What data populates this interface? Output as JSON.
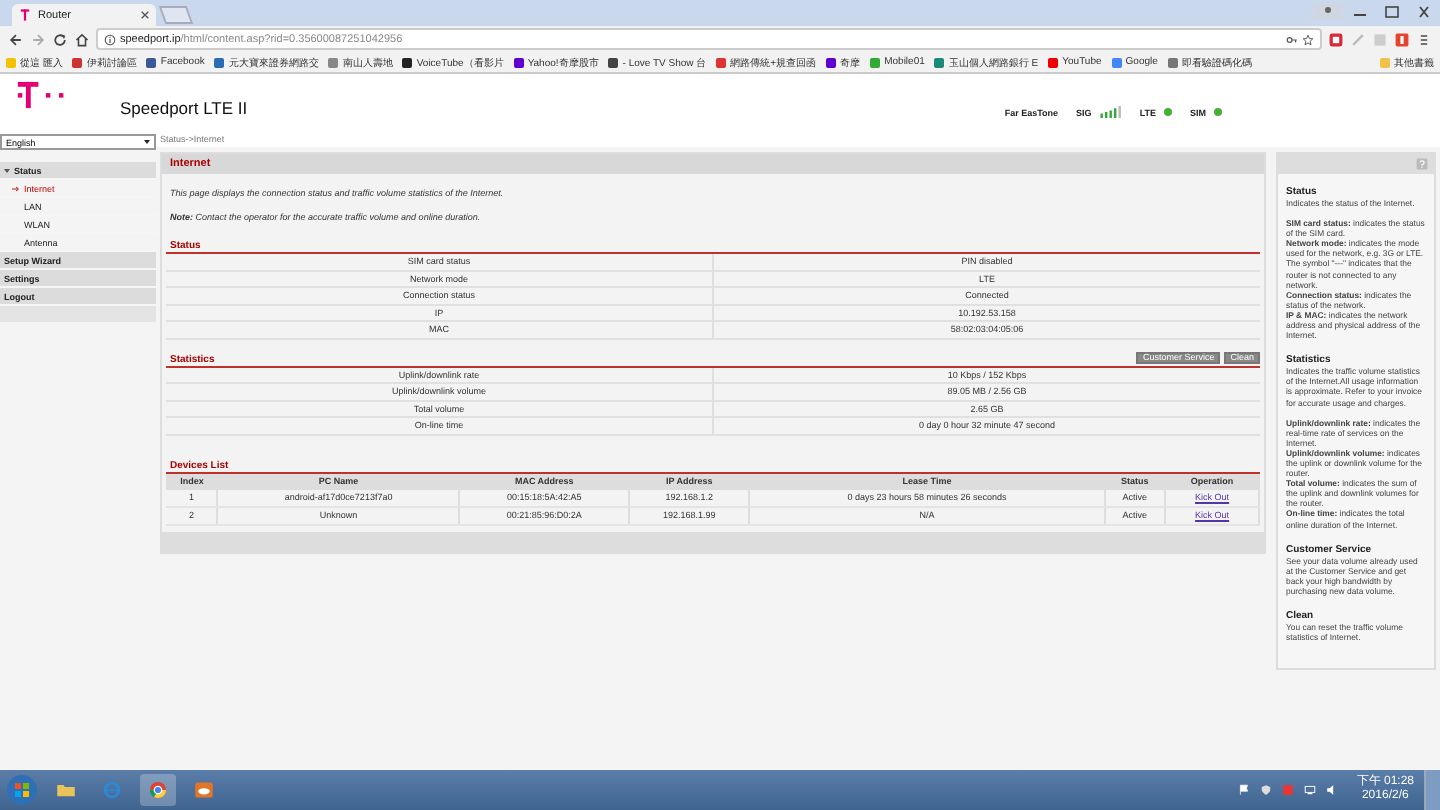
{
  "browser": {
    "tab_title": "Router",
    "url_host": "speedport.ip",
    "url_path": "/html/content.asp?rid=0.35600087251042956",
    "bookmarks": [
      "從這 匯入",
      "伊莉討論區",
      "Facebook",
      "元大寶來證券網路交",
      "南山人壽地",
      "VoiceTube（看影片",
      "Yahoo!奇摩股市",
      "- Love TV Show 台",
      "網路傳統+規查回函",
      "奇摩",
      "Mobile01",
      "玉山個人網路銀行 E",
      "YouTube",
      "Google",
      "即看驗證碼化碼"
    ],
    "other_bookmarks": "其他書籤"
  },
  "header": {
    "title": "Speedport LTE II",
    "operator": "Far EasTone",
    "signal_label": "SIG",
    "indicators": [
      {
        "label": "LTE",
        "color": "#44b035"
      },
      {
        "label": "SIM",
        "color": "#44b035"
      }
    ]
  },
  "sidebar": {
    "language": "English",
    "items": [
      {
        "label": "Status",
        "selected": false,
        "expanded": true,
        "children": [
          {
            "label": "Internet",
            "selected": true
          },
          {
            "label": "LAN",
            "selected": false
          },
          {
            "label": "WLAN",
            "selected": false
          },
          {
            "label": "Antenna",
            "selected": false
          }
        ]
      },
      {
        "label": "Setup Wizard",
        "selected": false
      },
      {
        "label": "Settings",
        "selected": false
      },
      {
        "label": "Logout",
        "selected": false
      }
    ]
  },
  "breadcrumb": "Status->Internet",
  "panel": {
    "title": "Internet",
    "intro": "This page displays the connection status and traffic volume statistics of the Internet.",
    "note": "**Note:** Contact the operator for the accurate traffic volume and online duration."
  },
  "status": {
    "title": "Status",
    "rows": [
      {
        "label": "SIM card status",
        "value": "PIN disabled"
      },
      {
        "label": "Network mode",
        "value": "LTE"
      },
      {
        "label": "Connection status",
        "value": "Connected"
      },
      {
        "label": "IP",
        "value": "10.192.53.158"
      },
      {
        "label": "MAC",
        "value": "58:02:03:04:05:06"
      }
    ]
  },
  "statistics": {
    "title": "Statistics",
    "buttons": [
      "Customer Service",
      "Clean"
    ],
    "rows": [
      {
        "label": "Uplink/downlink rate",
        "value": "10 Kbps / 152 Kbps"
      },
      {
        "label": "Uplink/downlink volume",
        "value": "89.05 MB / 2.56 GB"
      },
      {
        "label": "Total volume",
        "value": "2.65 GB"
      },
      {
        "label": "On-line time",
        "value": "0 day 0 hour 32 minute 47 second"
      }
    ]
  },
  "devices": {
    "title": "Devices List",
    "columns": [
      "Index",
      "PC Name",
      "MAC Address",
      "IP Address",
      "Lease Time",
      "Status",
      "Operation"
    ],
    "rows": [
      {
        "cells": [
          "1",
          "android-af17d0ce7213f7a0",
          "00:15:18:5A:42:A5",
          "192.168.1.2",
          "0 days 23 hours 58 minutes 26 seconds",
          "Active"
        ],
        "action": "Kick Out"
      },
      {
        "cells": [
          "2",
          "Unknown",
          "00:21:85:96:D0:2A",
          "192.168.1.99",
          "N/A",
          "Active"
        ],
        "action": "Kick Out"
      }
    ]
  },
  "help": {
    "sections": [
      {
        "title": "Status",
        "paragraphs": [
          "Indicates the status of the Internet.",
          "**SIM card status:** indicates the status of the SIM card.",
          "**Network mode:** indicates the mode used for the network, e.g. 3G or LTE. The symbol \"---\" indicates that the router is not connected to any network.",
          "**Connection status:** indicates the status of the network.",
          "**IP & MAC:** indicates the network address and physical address of the Internet."
        ]
      },
      {
        "title": "Statistics",
        "paragraphs": [
          "Indicates the traffic volume statistics of the Internet.All usage information is approximate. Refer to your invoice for accurate usage and charges.",
          "**Uplink/downlink rate:** indicates the real-time rate of services on the Internet.",
          "**Uplink/downlink volume:** indicates the uplink or downlink volume for the router.",
          "**Total volume:** indicates the sum of the uplink and downlink volumes for the router.",
          "**On-line time:** indicates the total online duration of the Internet."
        ]
      },
      {
        "title": "Customer Service",
        "paragraphs": [
          "See your data volume already used at the Customer Service and get back your high bandwidth by purchasing new data volume."
        ]
      },
      {
        "title": "Clean",
        "paragraphs": [
          "You can reset the traffic volume statistics of Internet."
        ]
      }
    ]
  },
  "taskbar": {
    "time": "下午 01:28",
    "date": "2016/2/6"
  }
}
